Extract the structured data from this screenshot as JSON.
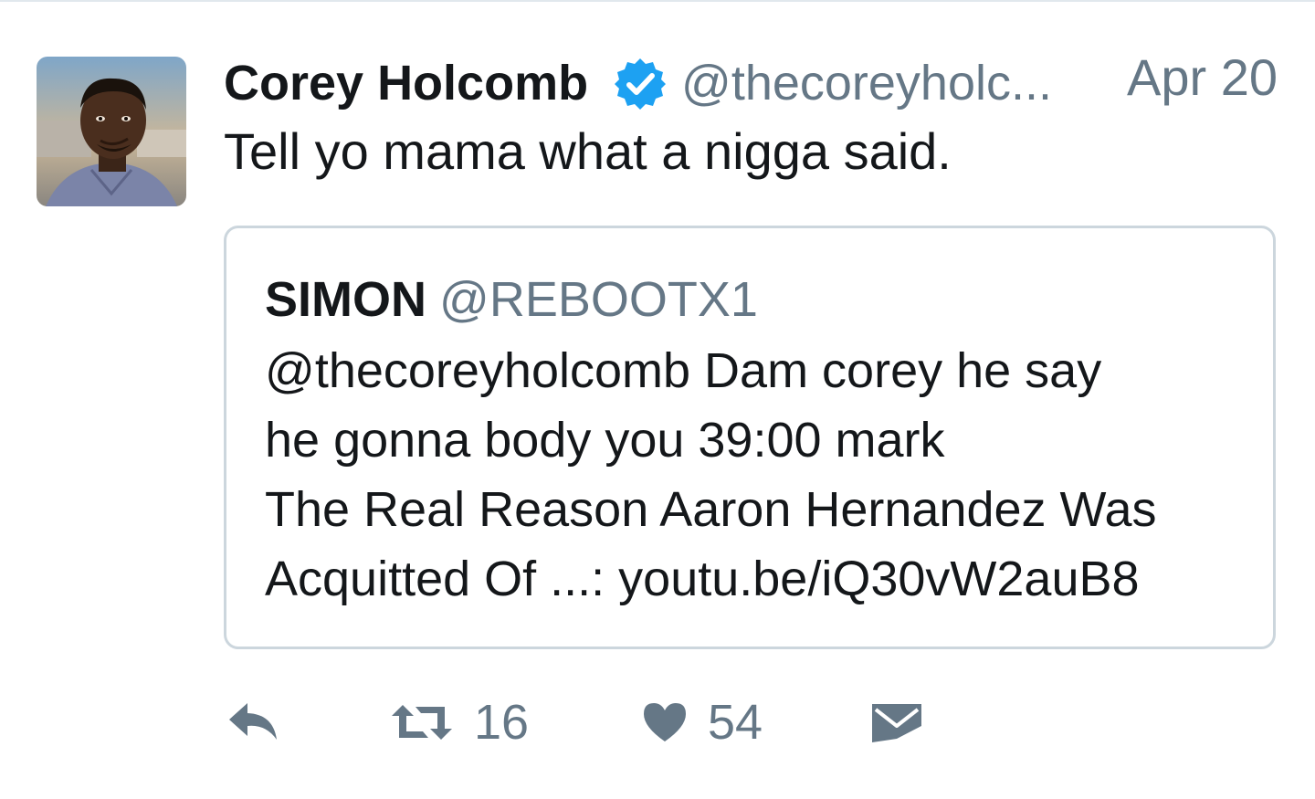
{
  "tweet": {
    "author": {
      "name": "Corey Holcomb",
      "handle": "@thecoreyholc...",
      "verified": true,
      "avatar": "profile-photo"
    },
    "date": "Apr 20",
    "text": "Tell yo mama what a nigga said.",
    "quoted": {
      "name": "SIMON",
      "handle": "@REBOOTX1",
      "lines": [
        "@thecoreyholcomb Dam corey he say",
        "he gonna body you 39:00 mark",
        "The Real Reason Aaron Hernandez Was",
        "Acquitted Of ...: youtu.be/iQ30vW2auB8"
      ]
    },
    "actions": {
      "reply": {
        "icon": "reply-icon"
      },
      "retweet": {
        "icon": "retweet-icon",
        "count": "16"
      },
      "like": {
        "icon": "heart-icon",
        "count": "54"
      },
      "dm": {
        "icon": "envelope-icon"
      }
    }
  },
  "colors": {
    "text": "#14171a",
    "secondary": "#657786",
    "verified": "#1da1f2",
    "border": "#ccd6dd"
  }
}
